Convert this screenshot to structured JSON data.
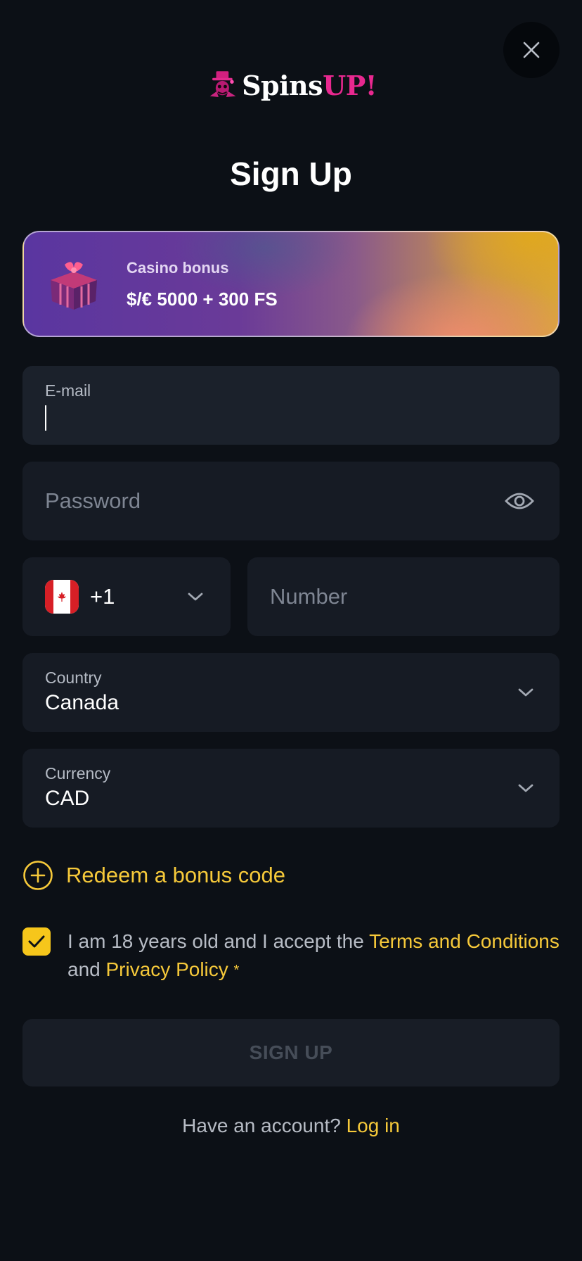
{
  "header": {
    "close_icon": "close-icon",
    "logo": {
      "text_part1": "Spins",
      "text_part2": "UP!",
      "mascot": "top-hat-skull-mascot"
    }
  },
  "title": "Sign Up",
  "bonus": {
    "label": "Casino bonus",
    "amount": "$/€ 5000 + 300 FS",
    "icon": "gift-icon"
  },
  "form": {
    "email": {
      "label": "E-mail",
      "value": ""
    },
    "password": {
      "placeholder": "Password",
      "icon": "eye-icon"
    },
    "phone": {
      "country_flag": "canada-flag-icon",
      "code": "+1",
      "number_placeholder": "Number"
    },
    "country": {
      "label": "Country",
      "value": "Canada"
    },
    "currency": {
      "label": "Currency",
      "value": "CAD"
    }
  },
  "redeem": {
    "label": "Redeem a bonus code",
    "icon": "plus-circle-icon"
  },
  "terms": {
    "checked": true,
    "text_before": "I am 18 years old and I accept the ",
    "terms_link": "Terms and Conditions",
    "text_and": " and ",
    "privacy_link": "Privacy Policy",
    "required_mark": "*"
  },
  "signup_button": "SIGN UP",
  "login": {
    "prompt": "Have an account?",
    "link": "Log in"
  },
  "colors": {
    "background": "#0c1016",
    "field": "#1b212b",
    "accent_yellow": "#f6c93a",
    "brand_pink": "#e8288f"
  }
}
